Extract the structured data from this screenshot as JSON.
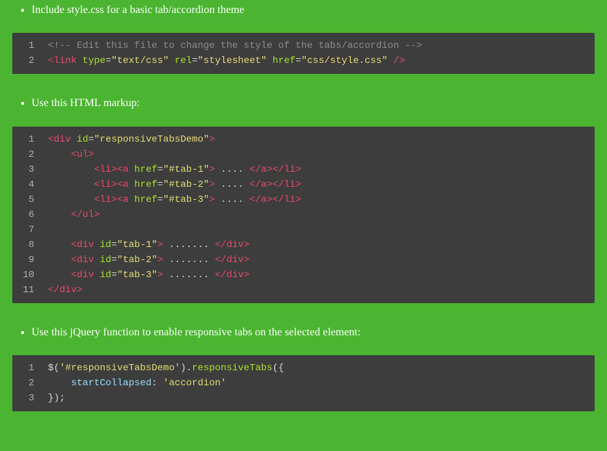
{
  "sections": [
    {
      "text": "Include style.css for a basic tab/accordion theme",
      "code": {
        "language": "html",
        "lines": [
          [
            {
              "cls": "c-comment",
              "t": "<!-- Edit this file to change the style of the tabs/accordion -->"
            }
          ],
          [
            {
              "cls": "c-tag",
              "t": "<link"
            },
            {
              "cls": "c-op",
              "t": " "
            },
            {
              "cls": "c-attr",
              "t": "type"
            },
            {
              "cls": "c-op",
              "t": "="
            },
            {
              "cls": "c-string",
              "t": "\"text/css\""
            },
            {
              "cls": "c-op",
              "t": " "
            },
            {
              "cls": "c-attr",
              "t": "rel"
            },
            {
              "cls": "c-op",
              "t": "="
            },
            {
              "cls": "c-string",
              "t": "\"stylesheet\""
            },
            {
              "cls": "c-op",
              "t": " "
            },
            {
              "cls": "c-attr",
              "t": "href"
            },
            {
              "cls": "c-op",
              "t": "="
            },
            {
              "cls": "c-string",
              "t": "\"css/style.css\""
            },
            {
              "cls": "c-op",
              "t": " "
            },
            {
              "cls": "c-tag",
              "t": "/>"
            }
          ]
        ]
      }
    },
    {
      "text": "Use this HTML markup:",
      "code": {
        "language": "html",
        "lines": [
          [
            {
              "cls": "c-tag",
              "t": "<div"
            },
            {
              "cls": "c-op",
              "t": " "
            },
            {
              "cls": "c-attr",
              "t": "id"
            },
            {
              "cls": "c-op",
              "t": "="
            },
            {
              "cls": "c-string",
              "t": "\"responsiveTabsDemo\""
            },
            {
              "cls": "c-tag",
              "t": ">"
            }
          ],
          [
            {
              "cls": "c-op",
              "t": "    "
            },
            {
              "cls": "c-tag",
              "t": "<ul>"
            }
          ],
          [
            {
              "cls": "c-op",
              "t": "        "
            },
            {
              "cls": "c-tag",
              "t": "<li><a"
            },
            {
              "cls": "c-op",
              "t": " "
            },
            {
              "cls": "c-attr",
              "t": "href"
            },
            {
              "cls": "c-op",
              "t": "="
            },
            {
              "cls": "c-string",
              "t": "\"#tab-1\""
            },
            {
              "cls": "c-tag",
              "t": ">"
            },
            {
              "cls": "c-dots",
              "t": " .... "
            },
            {
              "cls": "c-tag",
              "t": "</a></li>"
            }
          ],
          [
            {
              "cls": "c-op",
              "t": "        "
            },
            {
              "cls": "c-tag",
              "t": "<li><a"
            },
            {
              "cls": "c-op",
              "t": " "
            },
            {
              "cls": "c-attr",
              "t": "href"
            },
            {
              "cls": "c-op",
              "t": "="
            },
            {
              "cls": "c-string",
              "t": "\"#tab-2\""
            },
            {
              "cls": "c-tag",
              "t": ">"
            },
            {
              "cls": "c-dots",
              "t": " .... "
            },
            {
              "cls": "c-tag",
              "t": "</a></li>"
            }
          ],
          [
            {
              "cls": "c-op",
              "t": "        "
            },
            {
              "cls": "c-tag",
              "t": "<li><a"
            },
            {
              "cls": "c-op",
              "t": " "
            },
            {
              "cls": "c-attr",
              "t": "href"
            },
            {
              "cls": "c-op",
              "t": "="
            },
            {
              "cls": "c-string",
              "t": "\"#tab-3\""
            },
            {
              "cls": "c-tag",
              "t": ">"
            },
            {
              "cls": "c-dots",
              "t": " .... "
            },
            {
              "cls": "c-tag",
              "t": "</a></li>"
            }
          ],
          [
            {
              "cls": "c-op",
              "t": "    "
            },
            {
              "cls": "c-tag",
              "t": "</ul>"
            }
          ],
          [],
          [
            {
              "cls": "c-op",
              "t": "    "
            },
            {
              "cls": "c-tag",
              "t": "<div"
            },
            {
              "cls": "c-op",
              "t": " "
            },
            {
              "cls": "c-attr",
              "t": "id"
            },
            {
              "cls": "c-op",
              "t": "="
            },
            {
              "cls": "c-string",
              "t": "\"tab-1\""
            },
            {
              "cls": "c-tag",
              "t": ">"
            },
            {
              "cls": "c-dots",
              "t": " ....... "
            },
            {
              "cls": "c-tag",
              "t": "</div>"
            }
          ],
          [
            {
              "cls": "c-op",
              "t": "    "
            },
            {
              "cls": "c-tag",
              "t": "<div"
            },
            {
              "cls": "c-op",
              "t": " "
            },
            {
              "cls": "c-attr",
              "t": "id"
            },
            {
              "cls": "c-op",
              "t": "="
            },
            {
              "cls": "c-string",
              "t": "\"tab-2\""
            },
            {
              "cls": "c-tag",
              "t": ">"
            },
            {
              "cls": "c-dots",
              "t": " ....... "
            },
            {
              "cls": "c-tag",
              "t": "</div>"
            }
          ],
          [
            {
              "cls": "c-op",
              "t": "    "
            },
            {
              "cls": "c-tag",
              "t": "<div"
            },
            {
              "cls": "c-op",
              "t": " "
            },
            {
              "cls": "c-attr",
              "t": "id"
            },
            {
              "cls": "c-op",
              "t": "="
            },
            {
              "cls": "c-string",
              "t": "\"tab-3\""
            },
            {
              "cls": "c-tag",
              "t": ">"
            },
            {
              "cls": "c-dots",
              "t": " ....... "
            },
            {
              "cls": "c-tag",
              "t": "</div>"
            }
          ],
          [
            {
              "cls": "c-tag",
              "t": "</div>"
            }
          ]
        ]
      }
    },
    {
      "text": "Use this jQuery function to enable responsive tabs on the selected element:",
      "code": {
        "language": "javascript",
        "lines": [
          [
            {
              "cls": "c-op",
              "t": "$("
            },
            {
              "cls": "c-string",
              "t": "'#responsiveTabsDemo'"
            },
            {
              "cls": "c-op",
              "t": ")."
            },
            {
              "cls": "c-func",
              "t": "responsiveTabs"
            },
            {
              "cls": "c-op",
              "t": "({"
            }
          ],
          [
            {
              "cls": "c-op",
              "t": "    "
            },
            {
              "cls": "c-key",
              "t": "startCollapsed"
            },
            {
              "cls": "c-op",
              "t": ": "
            },
            {
              "cls": "c-string",
              "t": "'accordion'"
            }
          ],
          [
            {
              "cls": "c-op",
              "t": "});"
            }
          ]
        ]
      }
    }
  ]
}
